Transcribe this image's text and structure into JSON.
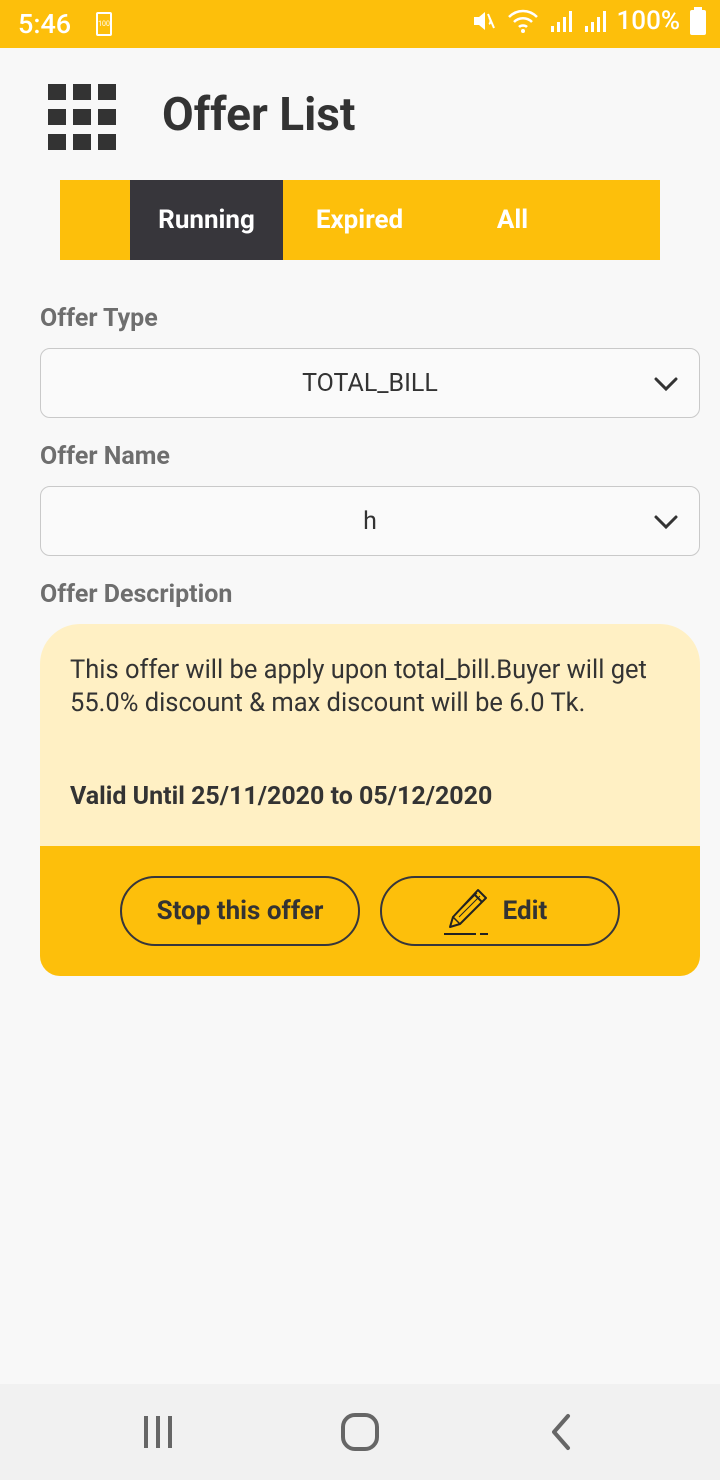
{
  "status_bar": {
    "time": "5:46",
    "battery_small": "100",
    "battery_percent": "100%"
  },
  "header": {
    "title": "Offer List"
  },
  "tabs": [
    {
      "label": "Running",
      "active": true
    },
    {
      "label": "Expired",
      "active": false
    },
    {
      "label": "All",
      "active": false
    }
  ],
  "form": {
    "offer_type_label": "Offer Type",
    "offer_type_value": "TOTAL_BILL",
    "offer_name_label": "Offer Name",
    "offer_name_value": "h",
    "offer_description_label": "Offer Description"
  },
  "offer": {
    "description": "This offer will be apply upon total_bill.Buyer will get 55.0% discount & max discount will be 6.0 Tk.",
    "validity": "Valid Until 25/11/2020 to 05/12/2020",
    "stop_label": "Stop this offer",
    "edit_label": "Edit"
  },
  "colors": {
    "accent": "#fdbf0b",
    "dark": "#37363b",
    "card_bg": "#fff0c4"
  }
}
